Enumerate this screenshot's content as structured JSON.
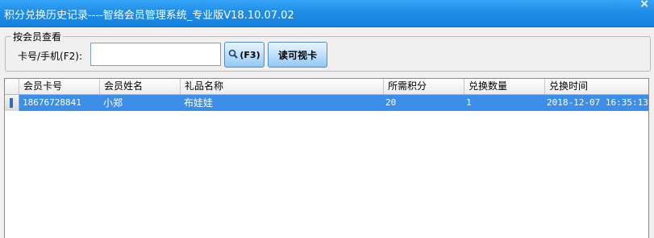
{
  "window": {
    "title": "积分兑换历史记录----智络会员管理系统_专业版V18.10.07.02",
    "close_glyph": "×"
  },
  "search": {
    "group_title": "按会员查看",
    "card_label": "卡号/手机(F2):",
    "card_value": "",
    "search_button": "(F3)",
    "read_card_button": "读可视卡"
  },
  "table": {
    "headers": [
      "会员卡号",
      "会员姓名",
      "礼品名称",
      "所需积分",
      "兑换数量",
      "兑换时间"
    ],
    "rows": [
      [
        "18676728841",
        "小郑",
        "布娃娃",
        "20",
        "1",
        "2018-12-07 16:35:13"
      ]
    ]
  },
  "colors": {
    "titlebar": "#1f8ee8",
    "selection": "#3d8ee8"
  }
}
